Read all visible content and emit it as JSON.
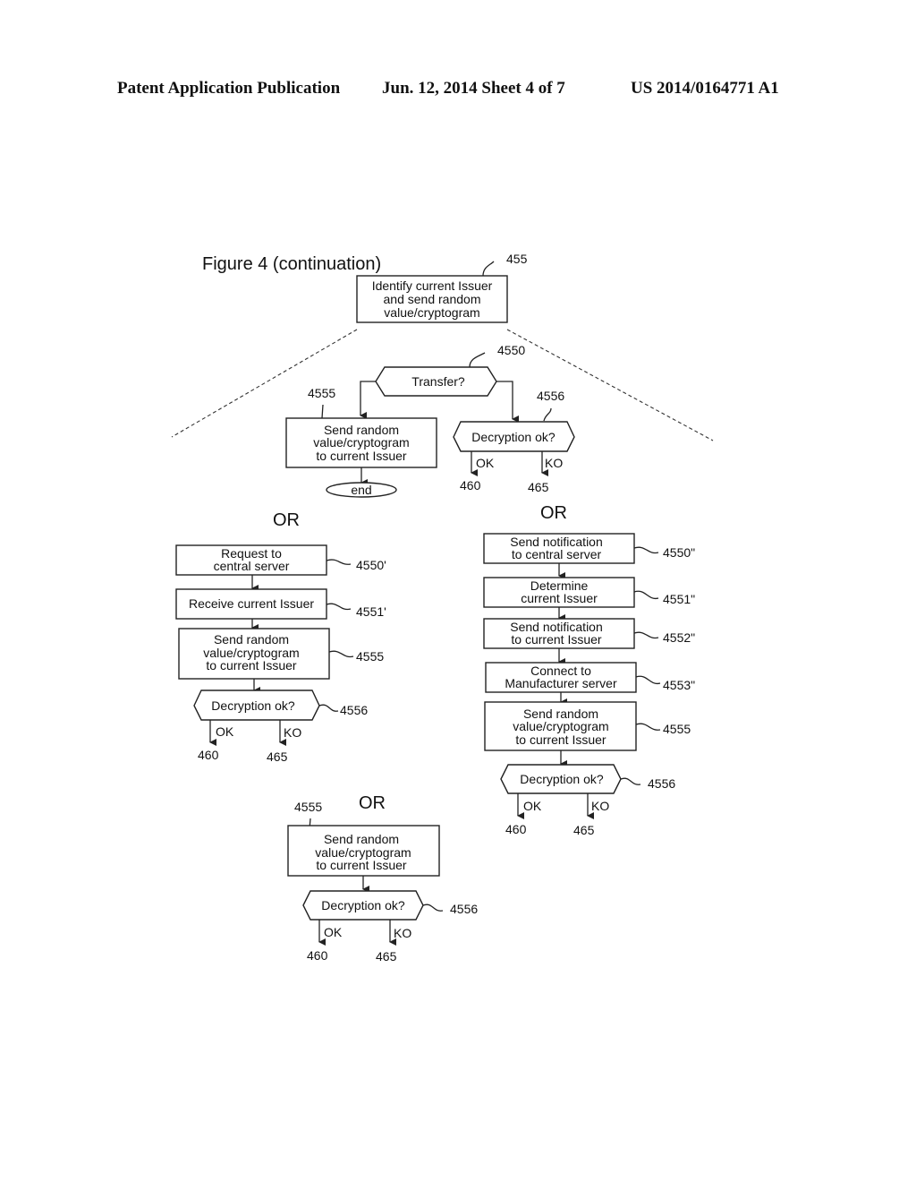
{
  "header": {
    "publication": "Patent Application Publication",
    "date_sheet": "Jun. 12, 2014  Sheet 4 of 7",
    "number": "US 2014/0164771 A1"
  },
  "figure": {
    "title": "Figure 4 (continuation)",
    "top": {
      "step": {
        "lines": [
          "Identify current Issuer",
          "and send random",
          "value/cryptogram"
        ],
        "ref": "455"
      },
      "decision": {
        "label": "Transfer?",
        "ref": "4550"
      },
      "send": {
        "lines": [
          "Send random",
          "value/cryptogram",
          "to current Issuer"
        ],
        "ref": "4555"
      },
      "end": "end",
      "check": {
        "label": "Decryption ok?",
        "ref": "4556",
        "ok": "OK",
        "ko": "KO",
        "ok_ref": "460",
        "ko_ref": "465"
      }
    },
    "or_label": "OR",
    "alt1": {
      "steps": [
        {
          "lines": [
            "Request to",
            "central server"
          ],
          "ref": "4550'"
        },
        {
          "lines": [
            "Receive current Issuer"
          ],
          "ref": "4551'"
        },
        {
          "lines": [
            "Send random",
            "value/cryptogram",
            "to current Issuer"
          ],
          "ref": "4555"
        }
      ],
      "check": {
        "label": "Decryption ok?",
        "ref": "4556",
        "ok": "OK",
        "ko": "KO",
        "ok_ref": "460",
        "ko_ref": "465"
      }
    },
    "alt2": {
      "steps": [
        {
          "lines": [
            "Send notification",
            "to central server"
          ],
          "ref": "4550\""
        },
        {
          "lines": [
            "Determine",
            "current Issuer"
          ],
          "ref": "4551\""
        },
        {
          "lines": [
            "Send notification",
            "to current Issuer"
          ],
          "ref": "4552\""
        },
        {
          "lines": [
            "Connect to",
            "Manufacturer server"
          ],
          "ref": "4553\""
        },
        {
          "lines": [
            "Send random",
            "value/cryptogram",
            "to current Issuer"
          ],
          "ref": "4555"
        }
      ],
      "check": {
        "label": "Decryption ok?",
        "ref": "4556",
        "ok": "OK",
        "ko": "KO",
        "ok_ref": "460",
        "ko_ref": "465"
      }
    },
    "alt3": {
      "steps": [
        {
          "lines": [
            "Send random",
            "value/cryptogram",
            "to current Issuer"
          ],
          "ref": "4555"
        }
      ],
      "check": {
        "label": "Decryption ok?",
        "ref": "4556",
        "ok": "OK",
        "ko": "KO",
        "ok_ref": "460",
        "ko_ref": "465"
      }
    }
  }
}
